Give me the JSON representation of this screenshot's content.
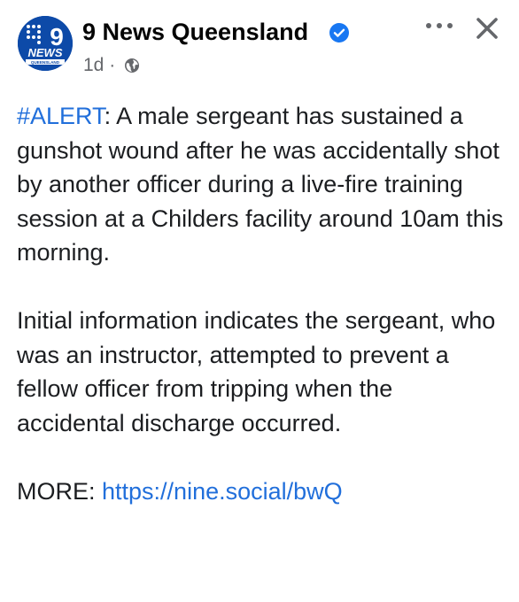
{
  "post": {
    "author": "9 News Queensland",
    "verified": true,
    "time": "1d",
    "separator": " · ",
    "privacy_icon": "globe-icon",
    "logo": {
      "number": "9",
      "word": "NEWS",
      "region": "QUEENSLAND"
    },
    "actions": {
      "more_icon": "more-horizontal-icon",
      "close_icon": "close-icon"
    },
    "body": {
      "hashtag": "#ALERT",
      "para1": ": A male sergeant has sustained a gunshot wound after he was accidentally shot by another officer during a live-fire training session at a Childers facility around 10am this morning.",
      "para2": "Initial information indicates the sergeant, who was an instructor, attempted to prevent a fellow officer from tripping when the accidental discharge occurred.",
      "more_label": "MORE: ",
      "link": "https://nine.social/bwQ"
    }
  },
  "colors": {
    "link": "#216fdb",
    "text": "#1c1e21",
    "meta": "#65676b",
    "verified": "#1877f2",
    "logo_bg": "#0d4aa8"
  }
}
